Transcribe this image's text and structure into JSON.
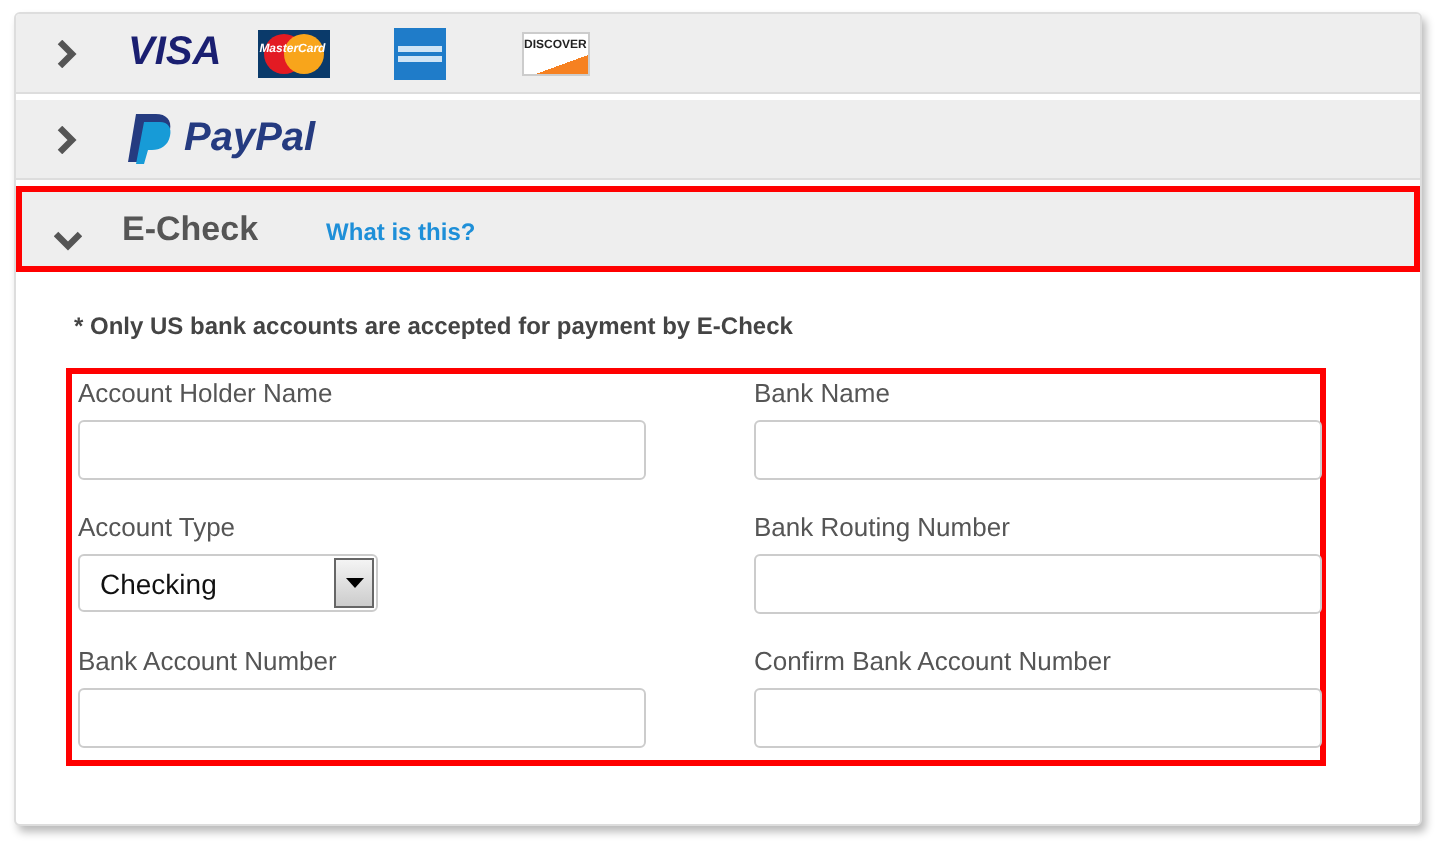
{
  "sections": [
    {
      "expanded": false,
      "highlighted": false,
      "logos": [
        {
          "kind": "visa",
          "text": "VISA"
        },
        {
          "kind": "mastercard",
          "text": "MasterCard"
        },
        {
          "kind": "amex"
        },
        {
          "kind": "discover",
          "text": "DISCOVER"
        }
      ]
    },
    {
      "expanded": false,
      "highlighted": false,
      "logos": [
        {
          "kind": "paypal",
          "text": "PayPal"
        }
      ]
    },
    {
      "expanded": true,
      "highlighted": true,
      "title": "E-Check",
      "link": "What is this?",
      "note": "* Only US bank accounts are accepted for payment by E-Check",
      "form": {
        "highlighted": true,
        "fields": [
          {
            "kind": "text",
            "label": "Account Holder Name"
          },
          {
            "kind": "text",
            "label": "Bank Name"
          },
          {
            "kind": "select",
            "label": "Account Type",
            "value": "Checking"
          },
          {
            "kind": "text",
            "label": "Bank Routing Number"
          },
          {
            "kind": "text",
            "label": "Bank Account Number"
          },
          {
            "kind": "text",
            "label": "Confirm Bank Account Number"
          }
        ]
      }
    }
  ]
}
